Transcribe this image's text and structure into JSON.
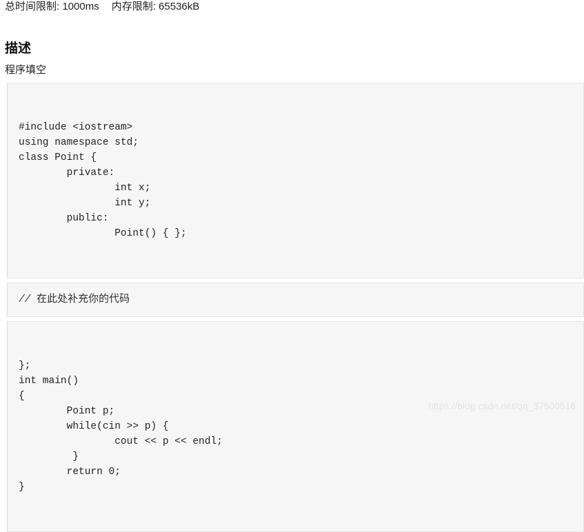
{
  "meta": {
    "time_limit": "总时间限制: 1000ms",
    "memory_limit": "内存限制: 65536kB"
  },
  "heading": "描述",
  "sub_label": "程序填空",
  "code_blocks": [
    {
      "id": "code-block-top",
      "kind": "code",
      "text": "#include <iostream>\nusing namespace std;\nclass Point {\n        private:\n                int x;\n                int y;\n        public:\n                Point() { };"
    },
    {
      "id": "code-block-fill-in",
      "kind": "comment",
      "marker": "// ",
      "text": "在此处补充你的代码"
    },
    {
      "id": "code-block-bottom",
      "kind": "code",
      "text": "};\nint main()\n{\n        Point p;\n        while(cin >> p) {\n                cout << p << endl;\n         }\n        return 0;\n}"
    }
  ],
  "watermark": "https://blog.csdn.net/qq_37500516"
}
